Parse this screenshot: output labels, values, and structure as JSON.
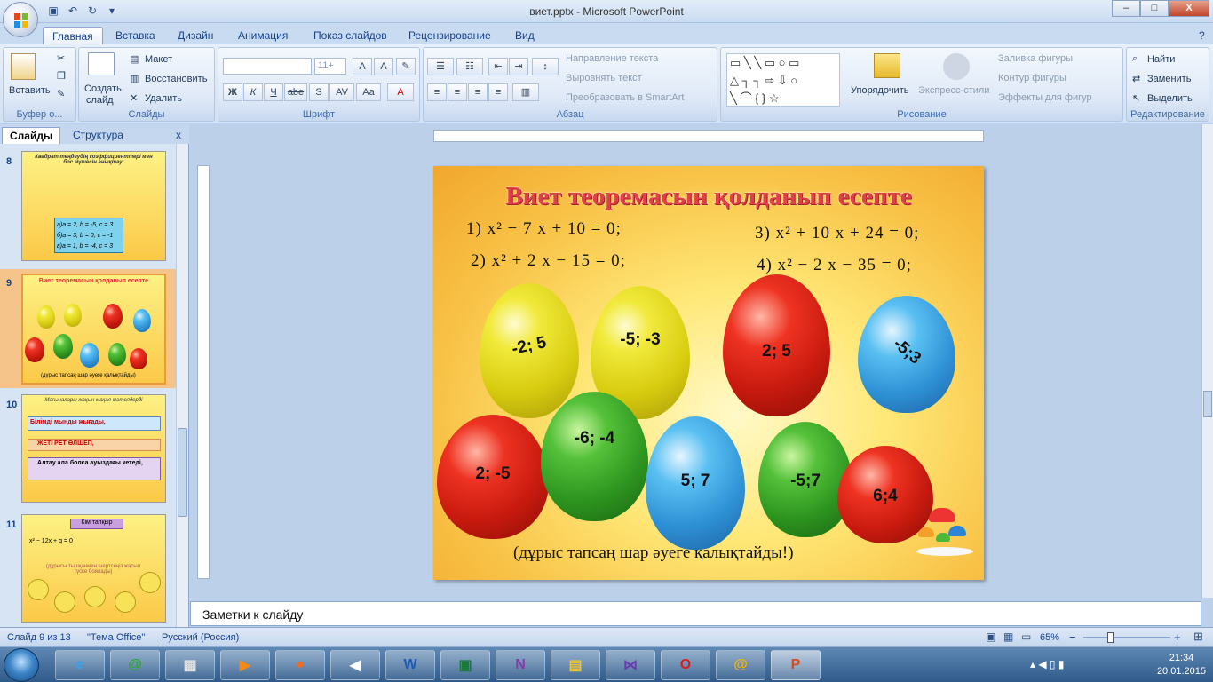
{
  "window": {
    "title": "виет.pptx - Microsoft PowerPoint",
    "minimize": "–",
    "maximize": "□",
    "close": "X"
  },
  "tabs": [
    "Главная",
    "Вставка",
    "Дизайн",
    "Анимация",
    "Показ слайдов",
    "Рецензирование",
    "Вид"
  ],
  "ribbon": {
    "clipboard": {
      "label": "Буфер о...",
      "paste": "Вставить"
    },
    "slides": {
      "label": "Слайды",
      "new_slide": "Создать",
      "new_slide2": "слайд",
      "layout": "Макет",
      "reset": "Восстановить",
      "delete": "Удалить"
    },
    "font": {
      "label": "Шрифт",
      "size": "11+",
      "bold": "Ж",
      "italic": "К",
      "underline": "Ч",
      "strike": "abe",
      "shadow": "S",
      "spacing": "AV",
      "case": "Aa"
    },
    "paragraph": {
      "label": "Абзац",
      "text_direction": "Направление текста",
      "align_text": "Выровнять текст",
      "smartart": "Преобразовать в SmartArt"
    },
    "drawing": {
      "label": "Рисование",
      "arrange": "Упорядочить",
      "quick_styles": "Экспресс-стили",
      "fill": "Заливка фигуры",
      "outline": "Контур фигуры",
      "effects": "Эффекты для фигур"
    },
    "editing": {
      "label": "Редактирование",
      "find": "Найти",
      "replace": "Заменить",
      "select": "Выделить"
    }
  },
  "pane": {
    "tab_slides": "Слайды",
    "tab_outline": "Структура",
    "close": "x",
    "thumbs": [
      {
        "num": "8",
        "title": "Квадрат теңдеудің коэффициенттері мен бос мүшесін анықтау:",
        "opts": [
          "а)a = 2, b = -5, c = 3",
          "б)a = 3, b = 0, c = -1",
          "в)a = 1, b = -4, c = 3"
        ]
      },
      {
        "num": "9",
        "title": "Виет теоремасын қолданып есепте",
        "caption": "(дұрыс тапсаң шар әуеге қалықтайды)"
      },
      {
        "num": "10",
        "title": "Мағыналары жақын мақал-мәтелдерді",
        "lines": [
          "Білімді мыңды жығады,",
          "ЖЕТІ РЕТ ӨЛШЕП,",
          "Алтау ала болса ауыздағы кетеді,"
        ]
      },
      {
        "num": "11",
        "title": "Кім тапқыр",
        "eq": "x² − 12x + q = 0",
        "note": "(дұрысы тышқанмен шертсеңіз жасыл түске боялады)"
      }
    ]
  },
  "slide": {
    "title": "Виет теоремасын қолданып есепте",
    "eq1": "1) x² − 7 x + 10  =  0;",
    "eq2": "2) x² + 2 x − 15  =  0;",
    "eq3": "3) x² + 10 x + 24  =  0;",
    "eq4": "4) x² − 2 x − 35  =  0;",
    "balloons": [
      {
        "label": "-2; 5",
        "color": "yellow"
      },
      {
        "label": "-5; -3",
        "color": "yellow"
      },
      {
        "label": "2; 5",
        "color": "red"
      },
      {
        "label": "-5;3",
        "color": "blue"
      },
      {
        "label": "2; -5",
        "color": "red"
      },
      {
        "label": "-6; -4",
        "color": "green"
      },
      {
        "label": "5; 7",
        "color": "blue"
      },
      {
        "label": "-5;7",
        "color": "green"
      },
      {
        "label": "6;4",
        "color": "red"
      }
    ],
    "caption": "(дұрыс тапсаң шар әуеге қалықтайды!)"
  },
  "notes_placeholder": "Заметки к слайду",
  "status": {
    "slide": "Слайд 9 из 13",
    "theme": "\"Тема Office\"",
    "language": "Русский (Россия)",
    "zoom": "65%",
    "zoom_minus": "−",
    "zoom_plus": "+"
  },
  "taskbar": {
    "time": "21:34",
    "date": "20.01.2015",
    "apps": [
      "ie-icon",
      "mail-agent-icon",
      "calculator-icon",
      "media-player-icon",
      "firefox-icon",
      "volume-icon",
      "word-icon",
      "image-icon",
      "onenote-icon",
      "explorer-icon",
      "vs-icon",
      "opera-icon",
      "mail-icon",
      "powerpoint-icon"
    ]
  },
  "colors": {
    "accent": "#15428b",
    "slide_title": "#e0404a"
  }
}
